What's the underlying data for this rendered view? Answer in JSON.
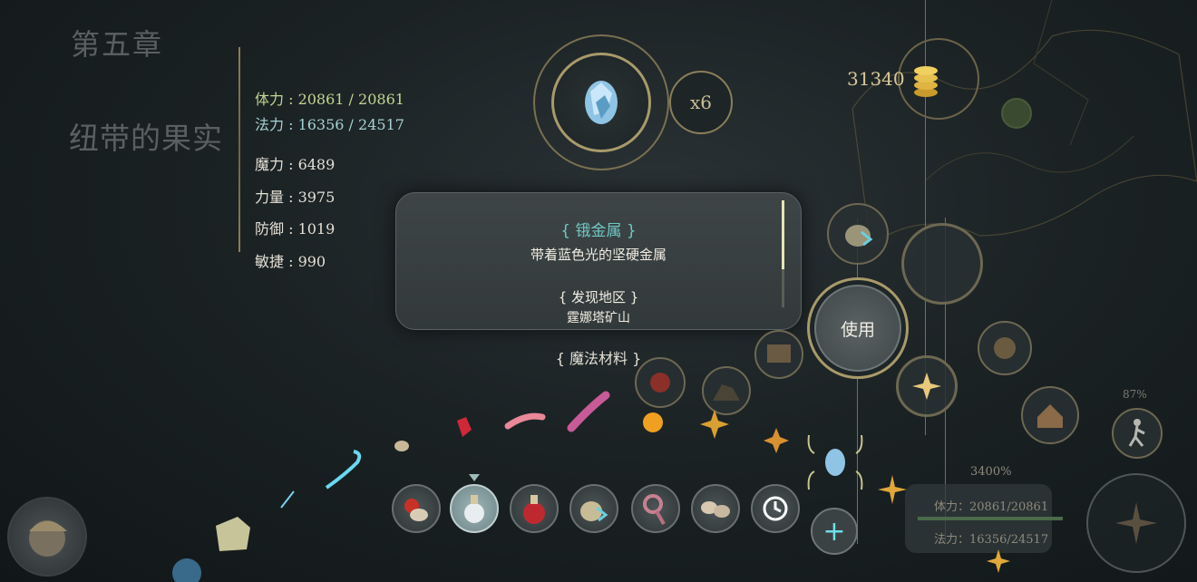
{
  "chapter": "第五章",
  "quest": "纽带的果实",
  "stats": {
    "hp": "体力 : 20861 / 20861",
    "mp": "法力 : 16356 / 24517",
    "magic": "魔力 : 6489",
    "strength": "力量 : 3975",
    "defense": "防御 : 1019",
    "agility": "敏捷 : 990"
  },
  "selected_item": {
    "icon": "blue-crystal-ore-icon",
    "count": "x6"
  },
  "gold": "31340",
  "tooltip": {
    "name": "{ 锇金属 }",
    "description": "带着蓝色光的坚硬金属",
    "region_heading": "{ 发现地区 }",
    "region": "霆娜塔矿山"
  },
  "category": "{ 魔法材料 }",
  "use_label": "使用",
  "hotbar": [
    {
      "icon": "food-bundle-icon"
    },
    {
      "icon": "flask-icon",
      "selected": true
    },
    {
      "icon": "red-potion-icon"
    },
    {
      "icon": "sack-icon"
    },
    {
      "icon": "staff-icon"
    },
    {
      "icon": "mushrooms-icon"
    },
    {
      "icon": "clock-icon"
    }
  ],
  "add_label": "+",
  "status": {
    "hp": "体力：20861/20861",
    "mp": "法力：16356/24517",
    "percent": "3400%",
    "small_percent": "87%"
  },
  "colors": {
    "accent_gold": "#a89a6a",
    "tooltip_name": "#6ec8c4",
    "hp_text": "#c2d690",
    "mp_text": "#a6d2d4"
  }
}
